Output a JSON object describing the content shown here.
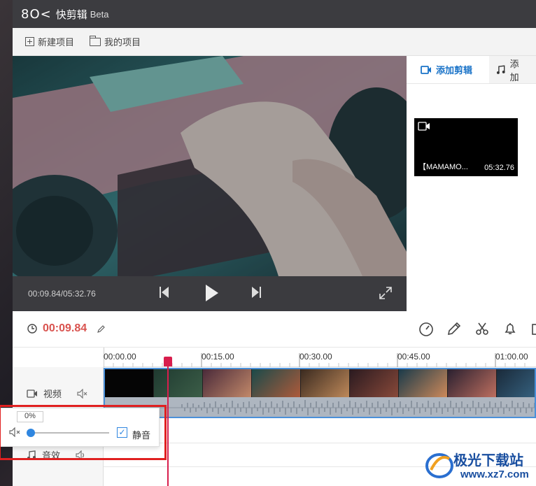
{
  "app": {
    "logo": "8O<",
    "title": "快剪辑",
    "badge": "Beta"
  },
  "toolbar": {
    "new_project": "新建项目",
    "my_projects": "我的项目"
  },
  "player": {
    "time": "00:09.84/05:32.76"
  },
  "panel": {
    "tabs": [
      {
        "label": "添加剪辑"
      },
      {
        "label": "添加"
      }
    ],
    "clip": {
      "name": "【MAMAMO...",
      "duration": "05:32.76"
    }
  },
  "timeline": {
    "current_time": "00:09.84",
    "ruler": [
      "00:00.00",
      "00:15.00",
      "00:30.00",
      "00:45.00",
      "01:00.00"
    ],
    "tracks": [
      {
        "label": "视频"
      },
      {
        "label": "音效"
      }
    ]
  },
  "volume": {
    "percent": "0%",
    "mute_label": "静音",
    "muted": true,
    "level": 0
  },
  "watermark": {
    "name": "极光下载站",
    "url": "www.xz7.com"
  },
  "colors": {
    "accent": "#1a73c8",
    "playhead": "#d81e4d",
    "time": "#d9534f",
    "highlight": "#e02020"
  }
}
